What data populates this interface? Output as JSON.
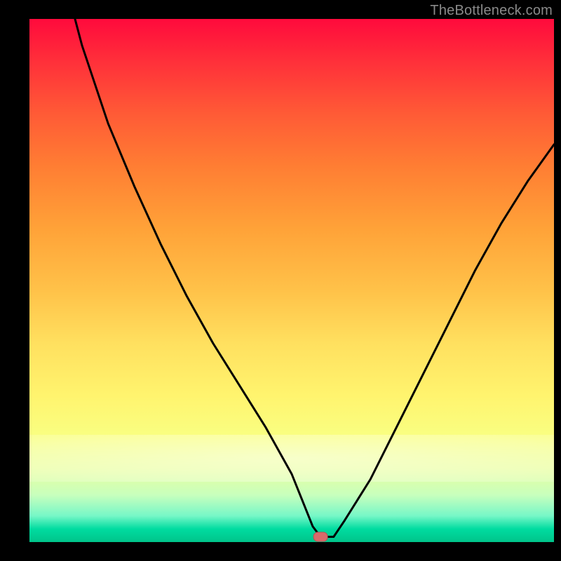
{
  "watermark": "TheBottleneck.com",
  "chart_data": {
    "type": "line",
    "title": "",
    "xlabel": "",
    "ylabel": "",
    "xlim": [
      0,
      100
    ],
    "ylim": [
      0,
      100
    ],
    "grid": false,
    "legend": false,
    "background": "vertical-rainbow-gradient",
    "marker": {
      "x": 55.5,
      "y": 1,
      "color": "#d96a6a",
      "shape": "rounded-rect"
    },
    "series": [
      {
        "name": "bottleneck-curve",
        "x": [
          0,
          5,
          10,
          15,
          20,
          25,
          30,
          35,
          40,
          45,
          50,
          52,
          54,
          55.5,
          58,
          60,
          65,
          70,
          75,
          80,
          85,
          90,
          95,
          100
        ],
        "y": [
          145,
          114,
          95,
          80,
          68,
          57,
          47,
          38,
          30,
          22,
          13,
          8,
          3,
          1,
          1,
          4,
          12,
          22,
          32,
          42,
          52,
          61,
          69,
          76
        ]
      }
    ]
  }
}
